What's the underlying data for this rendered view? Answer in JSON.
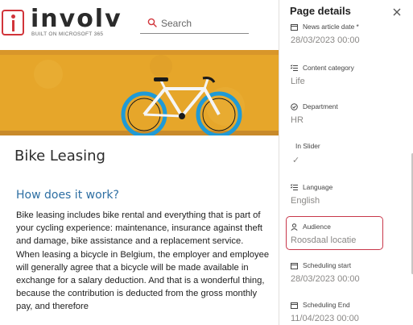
{
  "header": {
    "logo_text": "involv",
    "logo_subtitle": "BUILT ON MICROSOFT 365",
    "search_placeholder": "Search"
  },
  "article": {
    "title": "Bike Leasing",
    "section_heading": "How does it work?",
    "paragraph_1": "Bike leasing includes bike rental and everything that is part of your cycling experience: maintenance, insurance against theft and damage, bike assistance and a replacement service.",
    "paragraph_2": "When leasing a bicycle in Belgium, the employer and employee will generally agree that a bicycle will be made available in exchange for a salary deduction. And that is a wonderful thing, because the contribution is deducted from the gross monthly pay, and therefore"
  },
  "panel": {
    "title": "Page details",
    "fields": [
      {
        "label": "News article date *",
        "value": "28/03/2023 00:00",
        "icon": "calendar-icon"
      },
      {
        "label": "Content category",
        "value": "Life",
        "icon": "list-icon"
      },
      {
        "label": "Department",
        "value": "HR",
        "icon": "check-circle-icon"
      },
      {
        "label": "In Slider",
        "value": "✓",
        "icon": ""
      },
      {
        "label": "Language",
        "value": "English",
        "icon": "list-icon"
      },
      {
        "label": "Audience",
        "value": "Roosdaal locatie",
        "icon": "person-icon"
      },
      {
        "label": "Scheduling start",
        "value": "28/03/2023 00:00",
        "icon": "calendar-icon"
      },
      {
        "label": "Scheduling End",
        "value": "11/04/2023 00:00",
        "icon": "calendar-icon"
      }
    ]
  },
  "colors": {
    "brand_red": "#d1343a",
    "heading_blue": "#2e6fa3",
    "highlight_border": "#c8374a",
    "hero_yellow": "#e8a92c"
  }
}
